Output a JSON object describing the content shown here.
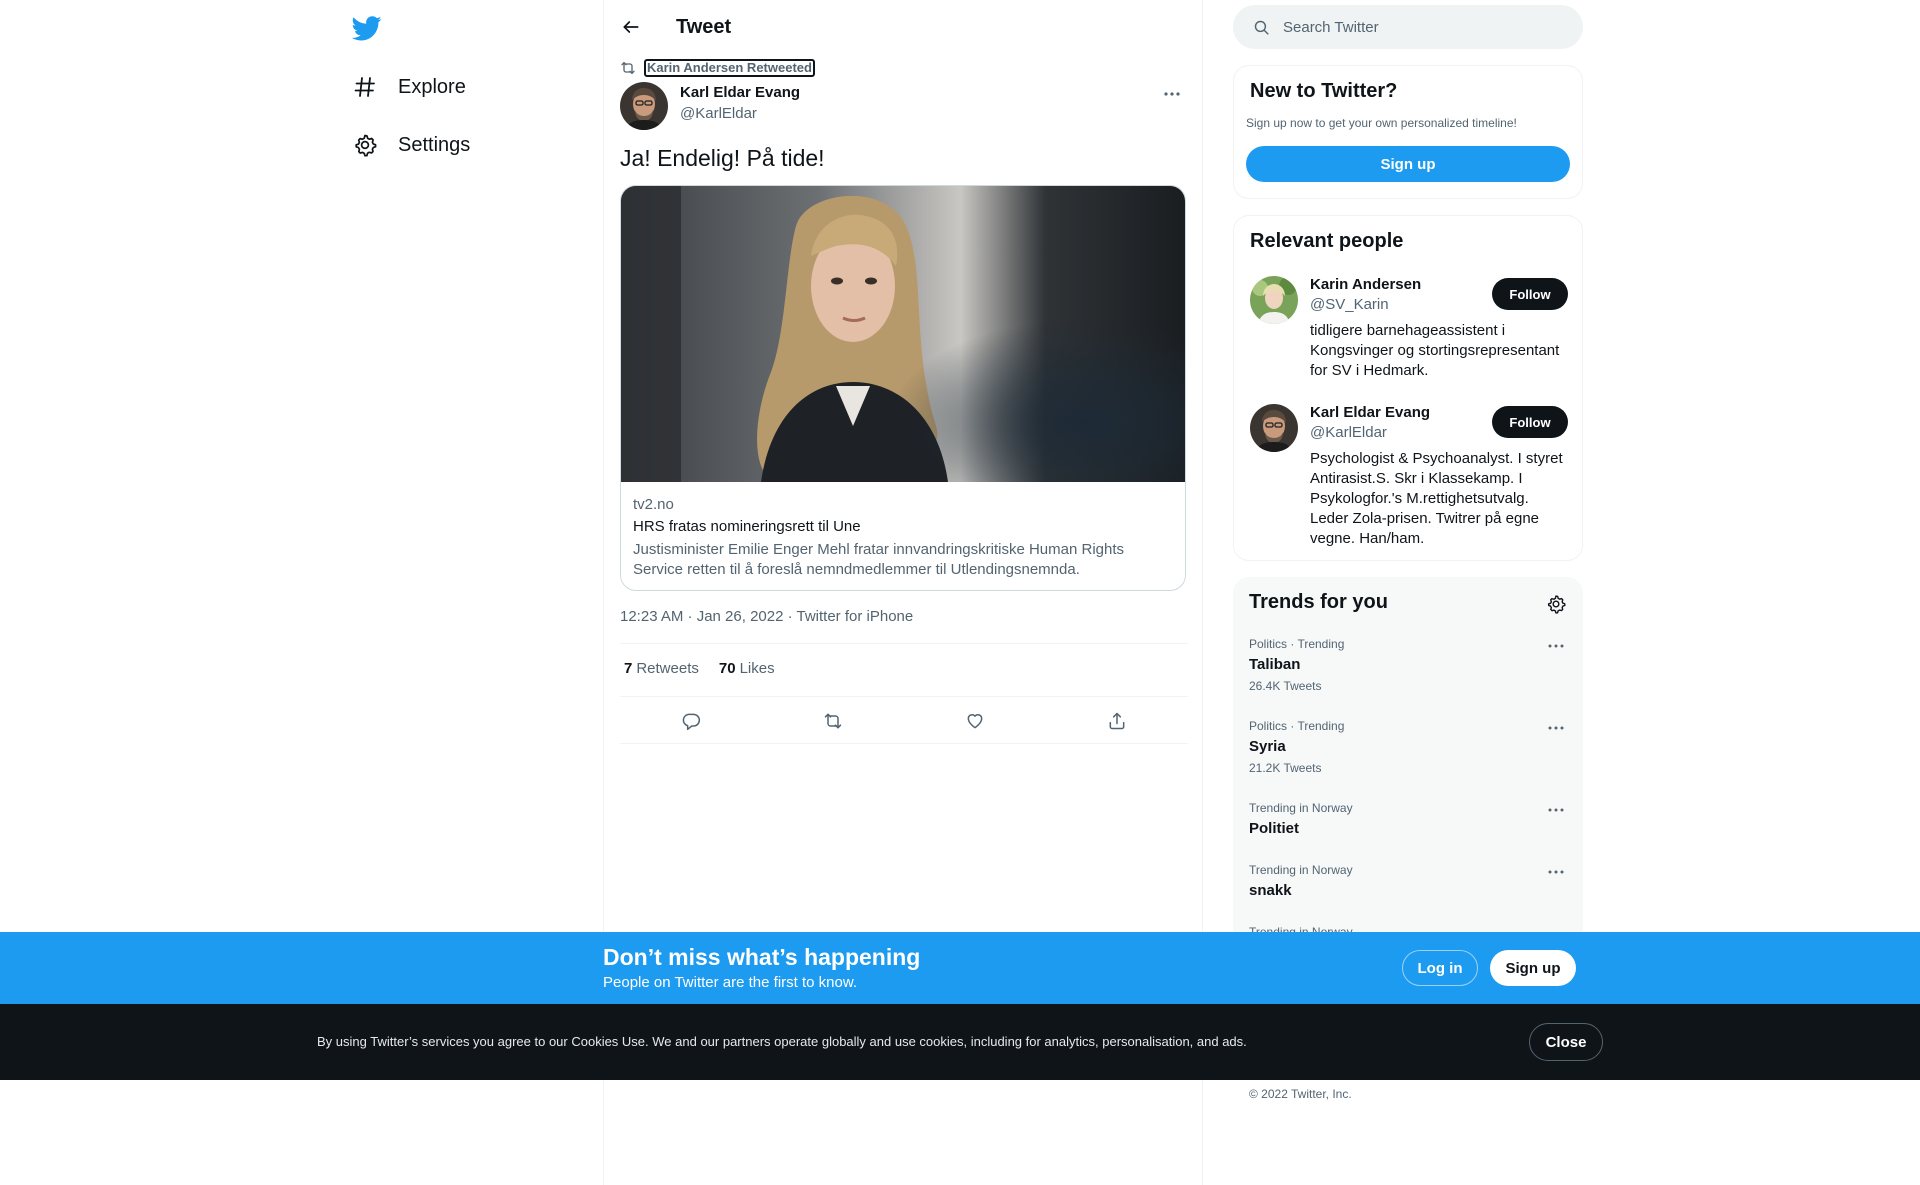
{
  "colors": {
    "brand": "#1d9bf0",
    "text": "#0f1419",
    "muted": "#536471",
    "dark_bar": "#0f1419"
  },
  "nav": {
    "logo_icon": "twitter-bird-icon",
    "items": [
      {
        "label": "Explore",
        "icon": "hashtag-icon"
      },
      {
        "label": "Settings",
        "icon": "gear-icon"
      }
    ]
  },
  "header": {
    "title": "Tweet",
    "back_icon": "arrow-left-icon"
  },
  "tweet": {
    "retweeted_by": "Karin Andersen Retweeted",
    "author_name": "Karl Eldar Evang",
    "author_handle": "@KarlEldar",
    "text": "Ja! Endelig! På tide!",
    "card": {
      "domain": "tv2.no",
      "title": "HRS fratas nomineringsrett til Une",
      "description": "Justisminister Emilie Enger Mehl fratar innvandringskritiske Human Rights Service retten til å foreslå nemndmedlemmer til Utlendingsnemnda."
    },
    "timestamp": "12:23 AM · Jan 26, 2022 · Twitter for iPhone",
    "retweets_count": "7",
    "retweets_label": "Retweets",
    "likes_count": "70",
    "likes_label": "Likes"
  },
  "search": {
    "placeholder": "Search Twitter"
  },
  "new_to_twitter": {
    "title": "New to Twitter?",
    "subtitle": "Sign up now to get your own personalized timeline!",
    "signup_label": "Sign up"
  },
  "relevant_people": {
    "title": "Relevant people",
    "people": [
      {
        "name": "Karin Andersen",
        "handle": "@SV_Karin",
        "bio": "tidligere barnehageassistent i Kongsvinger og stortingsrepresentant for SV i Hedmark.",
        "follow_label": "Follow"
      },
      {
        "name": "Karl Eldar Evang",
        "handle": "@KarlEldar",
        "bio": "Psychologist & Psychoanalyst. I styret Antirasist.S. Skr i Klassekamp. I Psykologfor.'s M.rettighetsutvalg. Leder Zola-prisen. Twitrer på egne vegne. Han/ham.",
        "follow_label": "Follow"
      }
    ]
  },
  "trends": {
    "title": "Trends for you",
    "items": [
      {
        "meta": "Politics · Trending",
        "name": "Taliban",
        "count": "26.4K Tweets"
      },
      {
        "meta": "Politics · Trending",
        "name": "Syria",
        "count": "21.2K Tweets"
      },
      {
        "meta": "Trending in Norway",
        "name": "Politiet",
        "count": ""
      },
      {
        "meta": "Trending in Norway",
        "name": "snakk",
        "count": ""
      },
      {
        "meta": "Trending in Norway",
        "name": "",
        "count": ""
      }
    ]
  },
  "copyright": "© 2022 Twitter, Inc.",
  "signup_bar": {
    "title": "Don’t miss what’s happening",
    "subtitle": "People on Twitter are the first to know.",
    "login_label": "Log in",
    "signup_label": "Sign up"
  },
  "cookie_bar": {
    "text": "By using Twitter’s services you agree to our Cookies Use. We and our partners operate globally and use cookies, including for analytics, personalisation, and ads.",
    "close_label": "Close"
  }
}
